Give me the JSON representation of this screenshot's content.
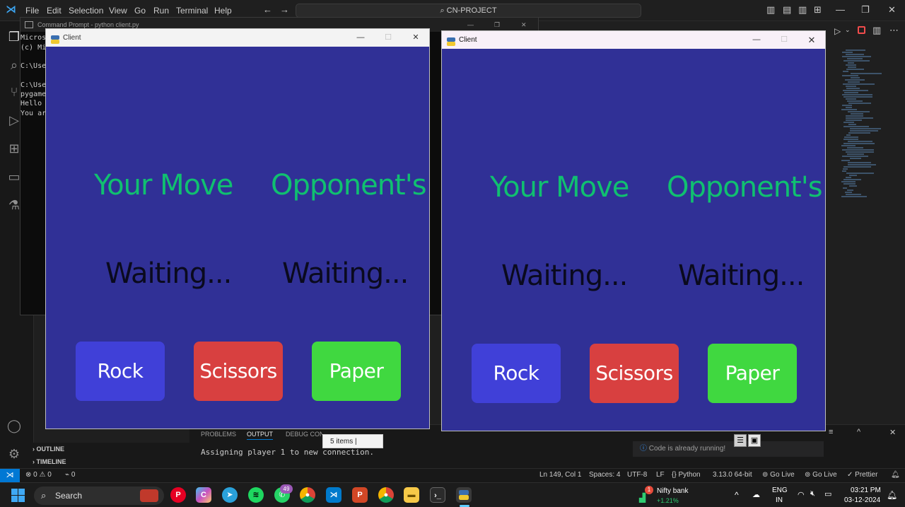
{
  "vscode": {
    "menu": [
      "File",
      "Edit",
      "Selection",
      "View",
      "Go",
      "Run",
      "Terminal",
      "Help"
    ],
    "command_center": "CN-PROJECT",
    "sidebar_sections": [
      "OUTLINE",
      "TIMELINE"
    ],
    "panel_tabs": [
      "PROBLEMS",
      "OUTPUT",
      "DEBUG CONSOLE"
    ],
    "terminal_line": "Assigning player 1 to new connection.",
    "explorer_status": "5 items  |",
    "notification": "Code is already running!",
    "status": {
      "errors": "0",
      "warnings": "0",
      "ports": "0",
      "position": "Ln 149, Col 1",
      "spaces": "Spaces: 4",
      "encoding": "UTF-8",
      "eol": "LF",
      "language": "Python",
      "interpreter": "3.13.0 64-bit",
      "golive1": "Go Live",
      "golive2": "Go Live",
      "prettier": "Prettier"
    }
  },
  "cmd": {
    "title": "Command Prompt - python  client.py",
    "lines": [
      "Micros",
      "(c) Mi",
      "",
      "C:\\User",
      "",
      "C:\\User",
      "pygame",
      "Hello -",
      "You are"
    ]
  },
  "clients": [
    {
      "title": "Client",
      "your_move": "Your Move",
      "opponent": "Opponent's",
      "your_status": "Waiting...",
      "opponent_status": "Waiting...",
      "buttons": [
        {
          "label": "Rock",
          "color": "#4040d8"
        },
        {
          "label": "Scissors",
          "color": "#d84040"
        },
        {
          "label": "Paper",
          "color": "#40d840"
        }
      ]
    },
    {
      "title": "Client",
      "your_move": "Your Move",
      "opponent": "Opponent's",
      "your_status": "Waiting...",
      "opponent_status": "Waiting...",
      "buttons": [
        {
          "label": "Rock",
          "color": "#4040d8"
        },
        {
          "label": "Scissors",
          "color": "#d84040"
        },
        {
          "label": "Paper",
          "color": "#40d840"
        }
      ]
    }
  ],
  "taskbar": {
    "search": "Search",
    "whatsapp_badge": "49",
    "stock_name": "Nifty bank",
    "stock_change": "+1.21%",
    "stock_badge": "1",
    "lang1": "ENG",
    "lang2": "IN",
    "time": "03:21 PM",
    "date": "03-12-2024"
  },
  "colors": {
    "game_bg": "#303096",
    "green_text": "#10c070",
    "accent_blue": "#0078d4"
  }
}
